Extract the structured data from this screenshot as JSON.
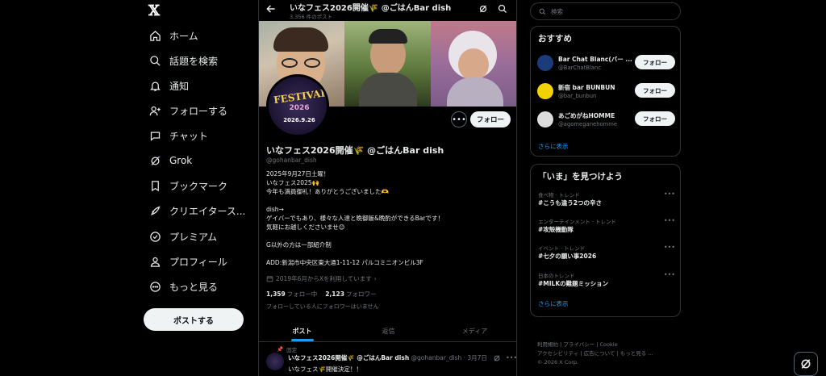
{
  "colors": {
    "accent": "#1d9bf0",
    "border": "#2f3336",
    "muted": "#71767b"
  },
  "nav": {
    "logo": "𝕏",
    "items": [
      {
        "label": "ホーム",
        "icon": "home-icon"
      },
      {
        "label": "話題を検索",
        "icon": "search-icon"
      },
      {
        "label": "通知",
        "icon": "bell-icon"
      },
      {
        "label": "フォローする",
        "icon": "add-user-icon"
      },
      {
        "label": "チャット",
        "icon": "chat-icon"
      },
      {
        "label": "Grok",
        "icon": "grok-icon"
      },
      {
        "label": "ブックマーク",
        "icon": "bookmark-icon"
      },
      {
        "label": "クリエイタース...",
        "icon": "rocket-icon"
      },
      {
        "label": "プレミアム",
        "icon": "verified-icon"
      },
      {
        "label": "プロフィール",
        "icon": "person-icon"
      },
      {
        "label": "もっと見る",
        "icon": "more-circle-icon"
      }
    ],
    "post_button": "ポストする"
  },
  "header": {
    "title": "いなフェス2026開催🌾 @ごはんBar dish",
    "post_count": "3,356 件のポスト"
  },
  "profile": {
    "avatar_text": {
      "fest": "FESTIVAL",
      "year": "2026",
      "date": "2026.9.26"
    },
    "follow_label": "フォロー",
    "name": "いなフェス2026開催🌾 @ごはんBar dish",
    "handle": "@gohanbar_dish",
    "bio": [
      "2025年9月27日土曜！",
      "いなフェス2025🙌",
      "今年も満員御礼！ありがとうございました🫶",
      "",
      "dish→",
      "ゲイバーでもあり、様々な人達と晩御飯&晩酌ができるBarです！",
      "気軽にお越しくださいませ😊",
      "",
      "G以外の方は一部紹介制",
      "",
      "ADD:新潟市中央区東大通1-11-12 パルコミニオンビル3F"
    ],
    "joined": "2019年6月からXを利用しています",
    "following_count": "1,359",
    "following_label": "フォロー中",
    "followers_count": "2,123",
    "followers_label": "フォロワー",
    "mutual": "フォローしている人にフォロワーはいません"
  },
  "tabs": [
    {
      "label": "ポスト"
    },
    {
      "label": "返信"
    },
    {
      "label": "メディア"
    }
  ],
  "pinned_post": {
    "pinned_label": "固定",
    "name": "いなフェス2026開催🌾 @ごはんBar dish",
    "meta": "@gohanbar_dish · 3月7日",
    "text": "いなフェス🌾開催決定！！"
  },
  "search": {
    "placeholder": "検索"
  },
  "suggestions": {
    "title": "おすすめ",
    "items": [
      {
        "name": "Bar Chat Blanc(バー ...",
        "handle": "@BarChatBlanc",
        "follow": "フォロー"
      },
      {
        "name": "新宿 bar BUNBUN",
        "handle": "@bar_bunbun",
        "follow": "フォロー"
      },
      {
        "name": "あごめがねHOMME",
        "handle": "@agomeganehomme",
        "follow": "フォロー"
      }
    ],
    "show_more": "さらに表示"
  },
  "trends": {
    "title": "「いま」を見つけよう",
    "items": [
      {
        "context": "食べ物 · トレンド",
        "title": "#こうも違う2つの辛さ"
      },
      {
        "context": "エンターテインメント · トレンド",
        "title": "#攻殻機動隊"
      },
      {
        "context": "イベント · トレンド",
        "title": "#七夕の願い事2026"
      },
      {
        "context": "日本のトレンド",
        "title": "#MILKの難題ミッション"
      }
    ],
    "show_more": "さらに表示"
  },
  "footer": {
    "line1": "利用規約 | プライバシー | Cookie",
    "line2": "アクセシビリティ | 広告について | もっと見る ...",
    "line3": "© 2026 X Corp."
  }
}
